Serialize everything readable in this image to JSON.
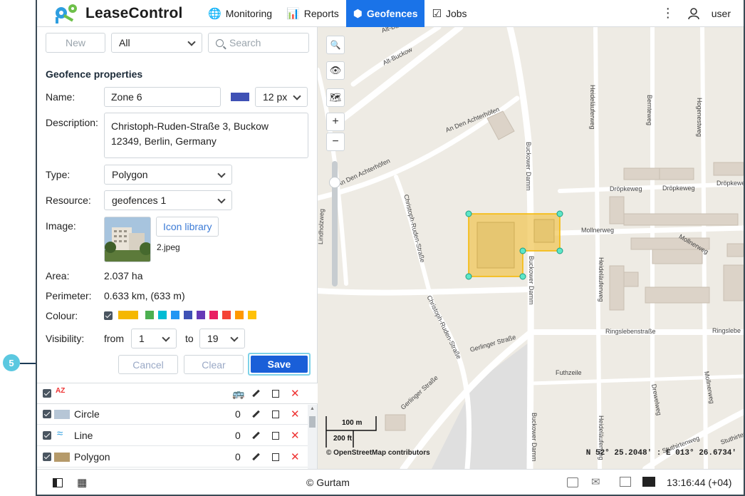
{
  "app": {
    "name": "LeaseControl"
  },
  "nav": {
    "items": [
      {
        "label": "Monitoring",
        "icon": "globe-icon",
        "active": false
      },
      {
        "label": "Reports",
        "icon": "report-icon",
        "active": false
      },
      {
        "label": "Geofences",
        "icon": "geofence-icon",
        "active": true
      },
      {
        "label": "Jobs",
        "icon": "jobs-icon",
        "active": false
      }
    ],
    "user": "user"
  },
  "toolbar": {
    "new_label": "New",
    "filter_value": "All",
    "search_placeholder": "Search"
  },
  "props": {
    "title": "Geofence properties",
    "name_label": "Name:",
    "name_value": "Zone 6",
    "line_width": "12 px",
    "description_label": "Description:",
    "description_value": "Christoph-Ruden-Straße 3, Buckow 12349, Berlin, Germany",
    "type_label": "Type:",
    "type_value": "Polygon",
    "resource_label": "Resource:",
    "resource_value": "geofences 1",
    "image_label": "Image:",
    "icon_library_label": "Icon library",
    "image_file": "2.jpeg",
    "area_label": "Area:",
    "area_value": "2.037 ha",
    "perimeter_label": "Perimeter:",
    "perimeter_value": "0.633 km, (633 m)",
    "colour_label": "Colour:",
    "colours": [
      "#f5b800",
      "#4caf50",
      "#00bcd4",
      "#2196f3",
      "#3f51b5",
      "#673ab7",
      "#e91e63",
      "#f44336",
      "#ff9800",
      "#ffc107"
    ],
    "selected_colour": "#3f51b5",
    "visibility_label": "Visibility:",
    "from_label": "from",
    "from_value": "1",
    "to_label": "to",
    "to_value": "19",
    "cancel_label": "Cancel",
    "clear_label": "Clear",
    "save_label": "Save"
  },
  "list": {
    "sort_label": "AZ",
    "rows": [
      {
        "name": "Circle",
        "count": "0"
      },
      {
        "name": "Line",
        "count": "0"
      },
      {
        "name": "Polygon",
        "count": "0"
      }
    ]
  },
  "map": {
    "streets": [
      "Alt-Buckow",
      "Alt-Buckow",
      "An Den Achterhöfen",
      "An Den Achterhöfen",
      "Lindholzweg",
      "Christoph-Ruden-Straße",
      "Christoph-Ruden-Straße",
      "Buckower Damm",
      "Buckower Damm",
      "Buckower Damm",
      "Heideläuferweg",
      "Bernteweg",
      "Hogenestweg",
      "Dröpkeweg",
      "Dröpkeweg",
      "Dröpkeweg",
      "Mollnerweg",
      "Mollnerweg",
      "Heideläuferweg",
      "Ringslebenstraße",
      "Ringslebe",
      "Gerlinger Straße",
      "Gerlinger Straße",
      "Futhzeile",
      "Drewelweg",
      "Mollnerweg",
      "Heideläuferweg",
      "Stuthirtenweg",
      "Stuthirtenweg"
    ],
    "scale_m": "100 m",
    "scale_ft": "200 ft",
    "attribution": "© OpenStreetMap contributors",
    "coordinates": "N 52° 25.2048' : E 013° 26.6734'"
  },
  "footer": {
    "copyright": "© Gurtam",
    "time": "13:16:44 (+04)"
  },
  "callout": {
    "number": "5"
  }
}
